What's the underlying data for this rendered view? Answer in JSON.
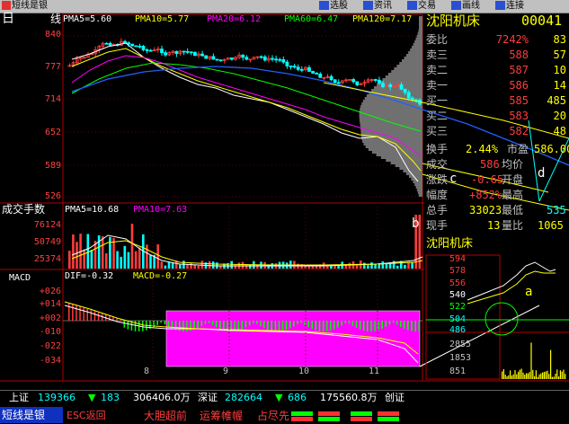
{
  "toolbar": {
    "app_title": "短线是银",
    "buttons": [
      "选股",
      "资讯",
      "交易",
      "画线",
      "连接"
    ]
  },
  "kline": {
    "period_label": "日",
    "line_label": "线",
    "pma5": "PMA5=5.60",
    "pma10": "PMA10=5.77",
    "pma20": "PMA20=6.12",
    "pma60": "PMA60=6.47",
    "pma120": "PMA120=7.17",
    "yticks": [
      "840",
      "777",
      "714",
      "652",
      "589",
      "526"
    ]
  },
  "volume": {
    "label": "成交手数",
    "pma5": "PMA5=10.68",
    "pma10": "PMA10=7.63",
    "yticks": [
      "76124",
      "50749",
      "25374"
    ]
  },
  "macd": {
    "label": "MACD",
    "dif": "DIF=-0.32",
    "macd": "MACD=-0.27",
    "yticks": [
      "+026",
      "+014",
      "+002",
      "-010",
      "-022",
      "-034"
    ]
  },
  "xaxis": [
    "8",
    "9",
    "10",
    "11"
  ],
  "stock": {
    "name": "沈阳机床",
    "code": "00041",
    "rows": [
      {
        "label": "委比",
        "v1": "7242%",
        "v2": "83"
      },
      {
        "label": "卖三",
        "v1": "588",
        "v2": "57"
      },
      {
        "label": "卖二",
        "v1": "587",
        "v2": "10"
      },
      {
        "label": "卖一",
        "v1": "586",
        "v2": "14"
      },
      {
        "label": "买一",
        "v1": "585",
        "v2": "485"
      },
      {
        "label": "买二",
        "v1": "583",
        "v2": "20"
      },
      {
        "label": "买三",
        "v1": "582",
        "v2": "48"
      }
    ],
    "turnover_label": "换手",
    "turnover": "2.44%",
    "pe_label": "市盈",
    "pe": "586.00",
    "deal_label": "成交",
    "deal": "586",
    "avg_label": "均价",
    "chg_label": "涨跌",
    "chg": "-0.65",
    "open_label": "开盘",
    "amp_label": "幅度",
    "amp": "+852%",
    "high_label": "最高",
    "vol_label": "总手",
    "vol": "33023",
    "low_label": "最低",
    "low": "535",
    "cur_label": "现手",
    "cur": "13",
    "qr_label": "量比",
    "qr": "1065"
  },
  "mini": {
    "name": "沈阳机床",
    "yticks": [
      "594",
      "578",
      "556",
      "540",
      "522",
      "504",
      "486"
    ],
    "vticks": [
      "2855",
      "1853",
      "851"
    ]
  },
  "annotations": {
    "a": "a",
    "b": "b",
    "c": "c",
    "d": "d"
  },
  "ticker": {
    "sh_label": "上证",
    "sh_value": "139366",
    "sh_change": "183",
    "sh_amount": "306406.0万",
    "sz_label": "深证",
    "sz_value": "282664",
    "sz_change": "686",
    "sz_amount": "175560.8万",
    "cy_label": "创证",
    "brand": "短线是银",
    "esc": "ESC返回",
    "msg1": "大胆超前",
    "msg2": "运筹帷幄",
    "msg3": "占尽先"
  },
  "colors": {
    "up": "#ff3c3c",
    "down": "#00ffff",
    "accent": "#ffff00",
    "panel_bg": "#000000"
  }
}
